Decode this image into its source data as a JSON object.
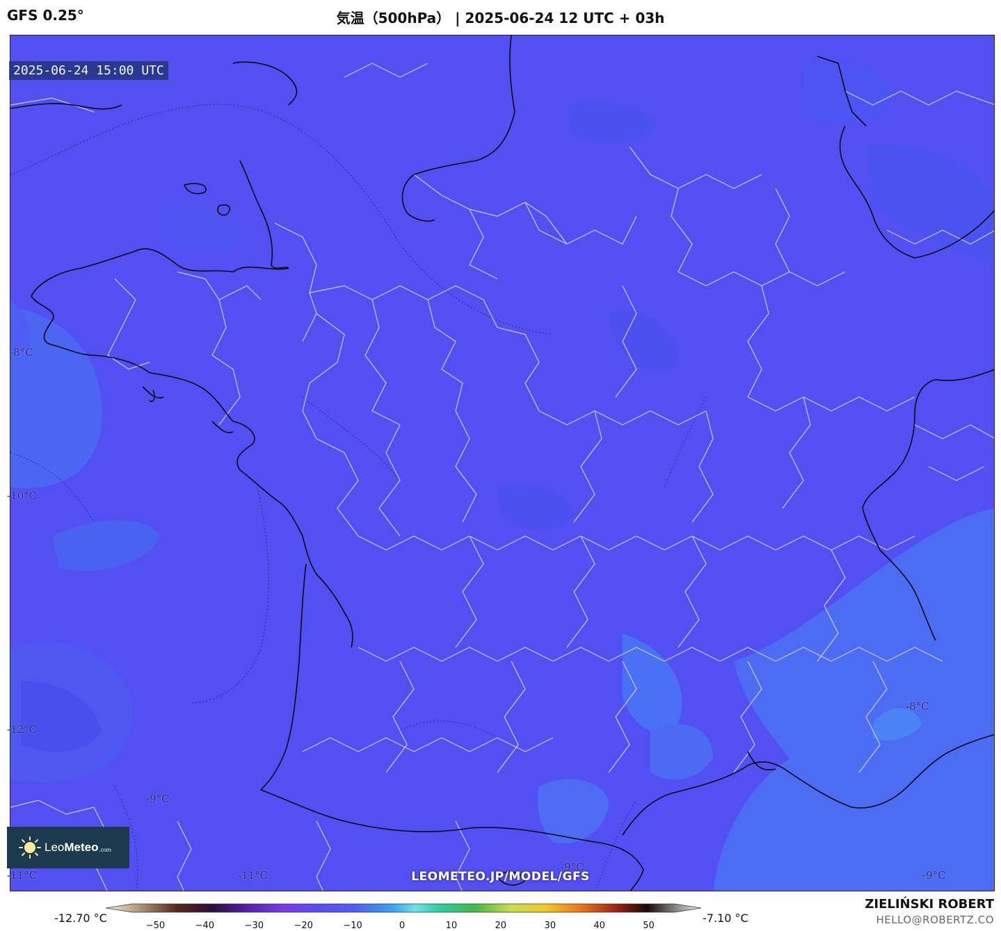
{
  "header": {
    "model": "GFS 0.25°",
    "title": "気温（500hPa） | 2025-06-24 12 UTC + 03h"
  },
  "map": {
    "timestamp": "2025-06-24 15:00 UTC",
    "base_color": "#5250f2",
    "isotherm_labels": [
      "-8°C",
      "-10°C",
      "-12°C",
      "-9°C",
      "-11°C",
      "-11°C",
      "-8°C",
      "-9°C",
      "-9°C"
    ]
  },
  "logo": {
    "part1": "Leo",
    "part2": "Meteo",
    "suffix": ".com"
  },
  "watermark_url": "LEOMETEO.JP/MODEL/GFS",
  "colorbar": {
    "min_label": "-12.70 °C",
    "max_label": "-7.10 °C",
    "ticks": [
      "−50",
      "−40",
      "−30",
      "−20",
      "−10",
      "0",
      "10",
      "20",
      "30",
      "40",
      "50"
    ],
    "range": [
      -55,
      55
    ]
  },
  "credits": {
    "author": "ZIELIŃSKI ROBERT",
    "email": "HELLO@ROBERTZ.CO"
  }
}
